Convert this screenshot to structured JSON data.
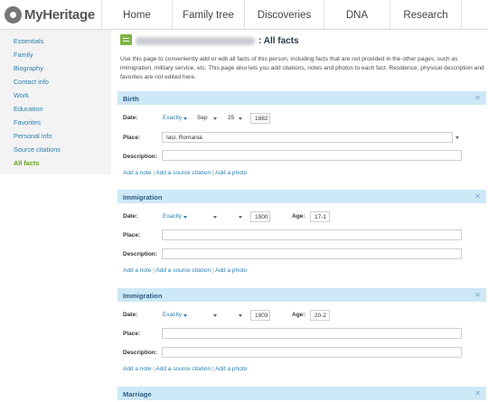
{
  "brand": {
    "name": "MyHeritage"
  },
  "nav": [
    "Home",
    "Family tree",
    "Discoveries",
    "DNA",
    "Research"
  ],
  "sidebar": [
    "Essentials",
    "Family",
    "Biography",
    "Contact info",
    "Work",
    "Education",
    "Favorites",
    "Personal info",
    "Source citations",
    "All facts"
  ],
  "active_sidebar": "All facts",
  "page": {
    "title_suffix": ": All facts",
    "intro": "Use this page to conveniently add or edit all facts of this person, including facts that are not provided in the other pages, such as immigration, military service, etc. This page also lets you add citations, notes and photos to each fact. Residence, physical description and favorites are not edited here."
  },
  "labels": {
    "date": "Date:",
    "place": "Place:",
    "description": "Description:",
    "age": "Age:"
  },
  "actions": {
    "add_note": "Add a note",
    "add_source": "Add a source citation",
    "add_photo": "Add a photo",
    "separator": "|"
  },
  "sections": [
    {
      "title": "Birth",
      "qualifier": "Exactly",
      "month": "Sep",
      "day": "25",
      "year": "1882",
      "place": "Iași, Romania",
      "age": "",
      "description": ""
    },
    {
      "title": "Immigration",
      "qualifier": "Exactly",
      "month": "",
      "day": "",
      "year": "1900",
      "place": "",
      "age": "17-1",
      "description": ""
    },
    {
      "title": "Immigration",
      "qualifier": "Exactly",
      "month": "",
      "day": "",
      "year": "1903",
      "place": "",
      "age": "20-2",
      "description": ""
    },
    {
      "title": "Marriage"
    }
  ],
  "icons": {
    "logo": "myheritage-logo-icon",
    "page": "notebook-icon",
    "close": "close-icon",
    "dropdown": "caret-down-icon"
  },
  "colors": {
    "section_header": "#cde8f7",
    "link": "#2a7fae",
    "active": "#6aa219"
  }
}
